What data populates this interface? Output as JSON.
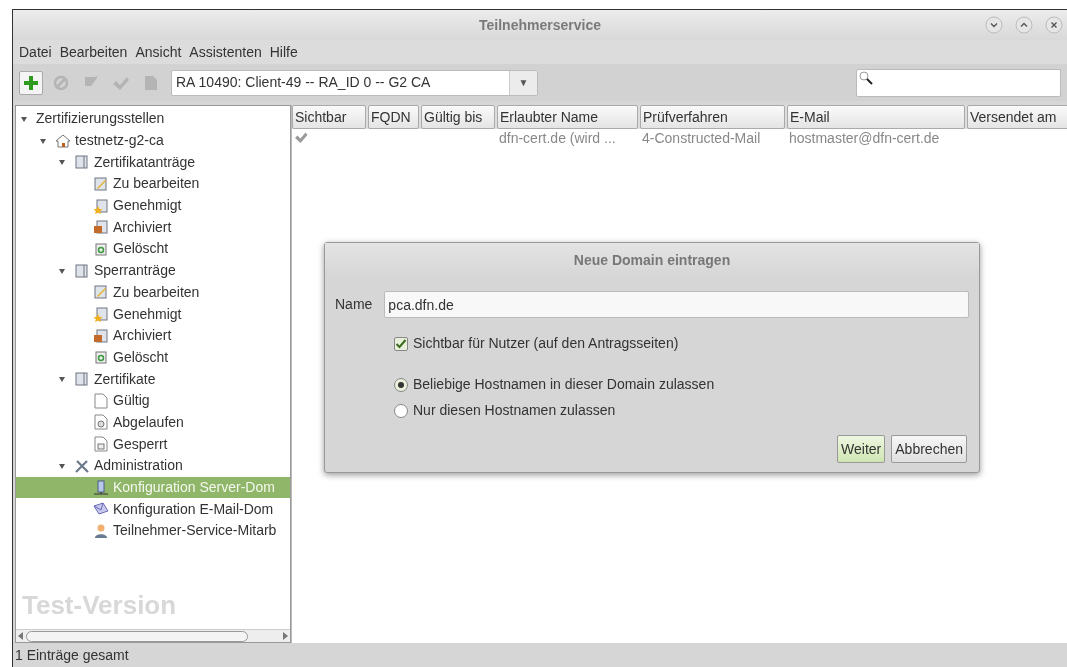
{
  "window": {
    "title": "Teilnehmerservice"
  },
  "menu": [
    "Datei",
    "Bearbeiten",
    "Ansicht",
    "Assistenten",
    "Hilfe"
  ],
  "toolbar": {
    "buttons": [
      {
        "kind": "add",
        "disabled": false
      },
      {
        "kind": "block",
        "disabled": true
      },
      {
        "kind": "edit",
        "disabled": true
      },
      {
        "kind": "check",
        "disabled": true
      },
      {
        "kind": "document",
        "disabled": true
      }
    ],
    "combo": {
      "value": "RA 10490: Client-49 -- RA_ID 0 -- G2 CA",
      "arrow": "▼"
    }
  },
  "tree": [
    {
      "label": "Zertifizierungsstellen",
      "expanded": true,
      "selected": false,
      "children": [
        {
          "label": "testnetz-g2-ca",
          "kind": "home",
          "expanded": true,
          "selected": false,
          "children": [
            {
              "label": "Zertifikatanträge",
              "kind": "folder",
              "expanded": true,
              "selected": false,
              "children": [
                {
                  "label": "Zu bearbeiten",
                  "kind": "edit",
                  "selected": false
                },
                {
                  "label": "Genehmigt",
                  "kind": "approved",
                  "selected": false
                },
                {
                  "label": "Archiviert",
                  "kind": "archive",
                  "selected": false
                },
                {
                  "label": "Gelöscht",
                  "kind": "deleted",
                  "selected": false
                }
              ]
            },
            {
              "label": "Sperranträge",
              "kind": "folder",
              "expanded": true,
              "selected": false,
              "children": [
                {
                  "label": "Zu bearbeiten",
                  "kind": "edit",
                  "selected": false
                },
                {
                  "label": "Genehmigt",
                  "kind": "approved",
                  "selected": false
                },
                {
                  "label": "Archiviert",
                  "kind": "archive",
                  "selected": false
                },
                {
                  "label": "Gelöscht",
                  "kind": "deleted",
                  "selected": false
                }
              ]
            },
            {
              "label": "Zertifikate",
              "kind": "folder",
              "expanded": true,
              "selected": false,
              "children": [
                {
                  "label": "Gültig",
                  "kind": "document",
                  "selected": false
                },
                {
                  "label": "Abgelaufen",
                  "kind": "expired",
                  "selected": false
                },
                {
                  "label": "Gesperrt",
                  "kind": "locked",
                  "selected": false
                }
              ]
            },
            {
              "label": "Administration",
              "kind": "tools",
              "expanded": true,
              "selected": false,
              "children": [
                {
                  "label": "Konfiguration Server-Dom",
                  "kind": "server",
                  "selected": true
                },
                {
                  "label": "Konfiguration E-Mail-Dom",
                  "kind": "mail",
                  "selected": false
                },
                {
                  "label": "Teilnehmer-Service-Mitarb",
                  "kind": "person",
                  "selected": false
                }
              ]
            }
          ]
        }
      ]
    }
  ],
  "sidebar_note": "Test-Version",
  "table": {
    "columns": [
      "Sichtbar",
      "FQDN",
      "Gültig bis",
      "Erlaubter Name",
      "Prüfverfahren",
      "E-Mail",
      "Versendet am"
    ],
    "rows": [
      {
        "visible": true,
        "erlaubter_name": "dfn-cert.de (wird ...",
        "pruefverfahren": "4-Constructed-Mail",
        "email": "hostmaster@dfn-cert.de"
      }
    ]
  },
  "dialog": {
    "title": "Neue Domain eintragen",
    "name_label": "Name",
    "name_value": "pca.dfn.de",
    "checkbox": {
      "label": "Sichtbar für Nutzer (auf den Antragsseiten)",
      "checked": true
    },
    "radios": [
      {
        "label": "Beliebige Hostnamen in dieser Domain zulassen",
        "selected": true
      },
      {
        "label": "Nur diesen Hostnamen zulassen",
        "selected": false
      }
    ],
    "buttons": [
      {
        "label": "Weiter",
        "primary": true
      },
      {
        "label": "Abbrechen",
        "primary": false
      }
    ]
  },
  "status_bar": "1 Einträge gesamt"
}
